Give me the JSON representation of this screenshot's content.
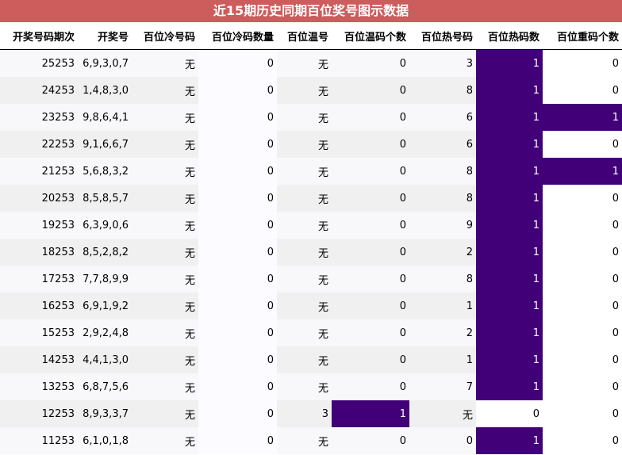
{
  "title": "近15期历史同期百位奖号图示数据",
  "columns": [
    "开奖号码期次",
    "开奖号",
    "百位冷号码",
    "百位冷码数量",
    "百位温号",
    "百位温码个数",
    "百位热号码",
    "百位热码数",
    "百位重码个数"
  ],
  "rows": [
    {
      "issue": "25253",
      "number": "6,9,3,0,7",
      "cold": "无",
      "cold_count": "0",
      "warm": "无",
      "warm_count": "0",
      "hot": "3",
      "hot_count": "1",
      "repeat": "0"
    },
    {
      "issue": "24253",
      "number": "1,4,8,3,0",
      "cold": "无",
      "cold_count": "0",
      "warm": "无",
      "warm_count": "0",
      "hot": "8",
      "hot_count": "1",
      "repeat": "0"
    },
    {
      "issue": "23253",
      "number": "9,8,6,4,1",
      "cold": "无",
      "cold_count": "0",
      "warm": "无",
      "warm_count": "0",
      "hot": "6",
      "hot_count": "1",
      "repeat": "1"
    },
    {
      "issue": "22253",
      "number": "9,1,6,6,7",
      "cold": "无",
      "cold_count": "0",
      "warm": "无",
      "warm_count": "0",
      "hot": "6",
      "hot_count": "1",
      "repeat": "0"
    },
    {
      "issue": "21253",
      "number": "5,6,8,3,2",
      "cold": "无",
      "cold_count": "0",
      "warm": "无",
      "warm_count": "0",
      "hot": "8",
      "hot_count": "1",
      "repeat": "1"
    },
    {
      "issue": "20253",
      "number": "8,5,8,5,7",
      "cold": "无",
      "cold_count": "0",
      "warm": "无",
      "warm_count": "0",
      "hot": "8",
      "hot_count": "1",
      "repeat": "0"
    },
    {
      "issue": "19253",
      "number": "6,3,9,0,6",
      "cold": "无",
      "cold_count": "0",
      "warm": "无",
      "warm_count": "0",
      "hot": "9",
      "hot_count": "1",
      "repeat": "0"
    },
    {
      "issue": "18253",
      "number": "8,5,2,8,2",
      "cold": "无",
      "cold_count": "0",
      "warm": "无",
      "warm_count": "0",
      "hot": "2",
      "hot_count": "1",
      "repeat": "0"
    },
    {
      "issue": "17253",
      "number": "7,7,8,9,9",
      "cold": "无",
      "cold_count": "0",
      "warm": "无",
      "warm_count": "0",
      "hot": "8",
      "hot_count": "1",
      "repeat": "0"
    },
    {
      "issue": "16253",
      "number": "6,9,1,9,2",
      "cold": "无",
      "cold_count": "0",
      "warm": "无",
      "warm_count": "0",
      "hot": "1",
      "hot_count": "1",
      "repeat": "0"
    },
    {
      "issue": "15253",
      "number": "2,9,2,4,8",
      "cold": "无",
      "cold_count": "0",
      "warm": "无",
      "warm_count": "0",
      "hot": "2",
      "hot_count": "1",
      "repeat": "0"
    },
    {
      "issue": "14253",
      "number": "4,4,1,3,0",
      "cold": "无",
      "cold_count": "0",
      "warm": "无",
      "warm_count": "0",
      "hot": "1",
      "hot_count": "1",
      "repeat": "0"
    },
    {
      "issue": "13253",
      "number": "6,8,7,5,6",
      "cold": "无",
      "cold_count": "0",
      "warm": "无",
      "warm_count": "0",
      "hot": "7",
      "hot_count": "1",
      "repeat": "0"
    },
    {
      "issue": "12253",
      "number": "8,9,3,3,7",
      "cold": "无",
      "cold_count": "0",
      "warm": "3",
      "warm_count": "1",
      "hot": "无",
      "hot_count": "0",
      "repeat": "0"
    },
    {
      "issue": "11253",
      "number": "6,1,0,1,8",
      "cold": "无",
      "cold_count": "0",
      "warm": "无",
      "warm_count": "0",
      "hot": "0",
      "hot_count": "1",
      "repeat": "0"
    }
  ],
  "colors": {
    "title_bg": "#cd5c5c",
    "highlight": "#410078",
    "row_odd": "#f8f8fa",
    "row_even": "#f0f0f0"
  }
}
